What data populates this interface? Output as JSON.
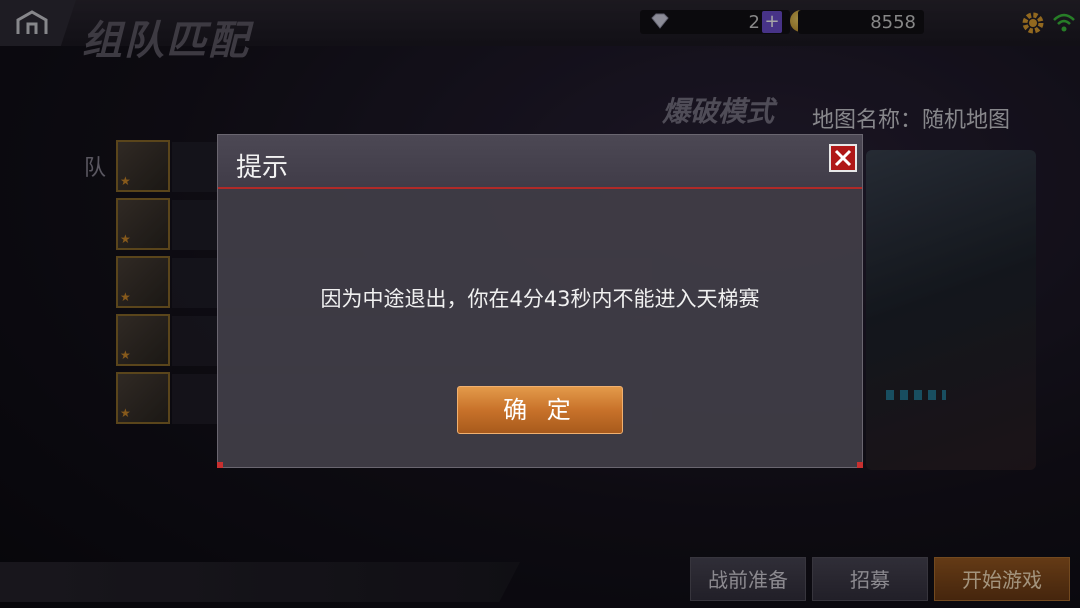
{
  "header": {
    "title": "组队匹配",
    "gems": "2",
    "coins": "8558"
  },
  "room": {
    "mode": "爆破模式",
    "map_name": "地图名称：随机地图",
    "team_label": "队"
  },
  "bottom_buttons": {
    "prep": "战前准备",
    "recruit": "招募",
    "start": "开始游戏"
  },
  "dialog": {
    "title": "提示",
    "message": "因为中途退出，你在4分43秒内不能进入天梯赛",
    "confirm": "确 定"
  },
  "colors": {
    "accent_red": "#b02a28",
    "button_orange": "#c8722a"
  }
}
